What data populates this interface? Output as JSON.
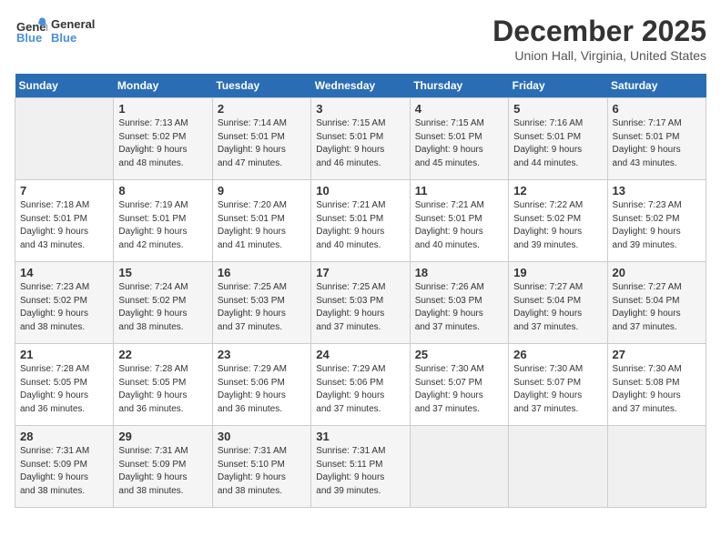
{
  "header": {
    "logo_general": "General",
    "logo_blue": "Blue",
    "month": "December 2025",
    "location": "Union Hall, Virginia, United States"
  },
  "days_of_week": [
    "Sunday",
    "Monday",
    "Tuesday",
    "Wednesday",
    "Thursday",
    "Friday",
    "Saturday"
  ],
  "weeks": [
    [
      {
        "day": "",
        "info": ""
      },
      {
        "day": "1",
        "info": "Sunrise: 7:13 AM\nSunset: 5:02 PM\nDaylight: 9 hours\nand 48 minutes."
      },
      {
        "day": "2",
        "info": "Sunrise: 7:14 AM\nSunset: 5:01 PM\nDaylight: 9 hours\nand 47 minutes."
      },
      {
        "day": "3",
        "info": "Sunrise: 7:15 AM\nSunset: 5:01 PM\nDaylight: 9 hours\nand 46 minutes."
      },
      {
        "day": "4",
        "info": "Sunrise: 7:15 AM\nSunset: 5:01 PM\nDaylight: 9 hours\nand 45 minutes."
      },
      {
        "day": "5",
        "info": "Sunrise: 7:16 AM\nSunset: 5:01 PM\nDaylight: 9 hours\nand 44 minutes."
      },
      {
        "day": "6",
        "info": "Sunrise: 7:17 AM\nSunset: 5:01 PM\nDaylight: 9 hours\nand 43 minutes."
      }
    ],
    [
      {
        "day": "7",
        "info": "Sunrise: 7:18 AM\nSunset: 5:01 PM\nDaylight: 9 hours\nand 43 minutes."
      },
      {
        "day": "8",
        "info": "Sunrise: 7:19 AM\nSunset: 5:01 PM\nDaylight: 9 hours\nand 42 minutes."
      },
      {
        "day": "9",
        "info": "Sunrise: 7:20 AM\nSunset: 5:01 PM\nDaylight: 9 hours\nand 41 minutes."
      },
      {
        "day": "10",
        "info": "Sunrise: 7:21 AM\nSunset: 5:01 PM\nDaylight: 9 hours\nand 40 minutes."
      },
      {
        "day": "11",
        "info": "Sunrise: 7:21 AM\nSunset: 5:01 PM\nDaylight: 9 hours\nand 40 minutes."
      },
      {
        "day": "12",
        "info": "Sunrise: 7:22 AM\nSunset: 5:02 PM\nDaylight: 9 hours\nand 39 minutes."
      },
      {
        "day": "13",
        "info": "Sunrise: 7:23 AM\nSunset: 5:02 PM\nDaylight: 9 hours\nand 39 minutes."
      }
    ],
    [
      {
        "day": "14",
        "info": "Sunrise: 7:23 AM\nSunset: 5:02 PM\nDaylight: 9 hours\nand 38 minutes."
      },
      {
        "day": "15",
        "info": "Sunrise: 7:24 AM\nSunset: 5:02 PM\nDaylight: 9 hours\nand 38 minutes."
      },
      {
        "day": "16",
        "info": "Sunrise: 7:25 AM\nSunset: 5:03 PM\nDaylight: 9 hours\nand 37 minutes."
      },
      {
        "day": "17",
        "info": "Sunrise: 7:25 AM\nSunset: 5:03 PM\nDaylight: 9 hours\nand 37 minutes."
      },
      {
        "day": "18",
        "info": "Sunrise: 7:26 AM\nSunset: 5:03 PM\nDaylight: 9 hours\nand 37 minutes."
      },
      {
        "day": "19",
        "info": "Sunrise: 7:27 AM\nSunset: 5:04 PM\nDaylight: 9 hours\nand 37 minutes."
      },
      {
        "day": "20",
        "info": "Sunrise: 7:27 AM\nSunset: 5:04 PM\nDaylight: 9 hours\nand 37 minutes."
      }
    ],
    [
      {
        "day": "21",
        "info": "Sunrise: 7:28 AM\nSunset: 5:05 PM\nDaylight: 9 hours\nand 36 minutes."
      },
      {
        "day": "22",
        "info": "Sunrise: 7:28 AM\nSunset: 5:05 PM\nDaylight: 9 hours\nand 36 minutes."
      },
      {
        "day": "23",
        "info": "Sunrise: 7:29 AM\nSunset: 5:06 PM\nDaylight: 9 hours\nand 36 minutes."
      },
      {
        "day": "24",
        "info": "Sunrise: 7:29 AM\nSunset: 5:06 PM\nDaylight: 9 hours\nand 37 minutes."
      },
      {
        "day": "25",
        "info": "Sunrise: 7:30 AM\nSunset: 5:07 PM\nDaylight: 9 hours\nand 37 minutes."
      },
      {
        "day": "26",
        "info": "Sunrise: 7:30 AM\nSunset: 5:07 PM\nDaylight: 9 hours\nand 37 minutes."
      },
      {
        "day": "27",
        "info": "Sunrise: 7:30 AM\nSunset: 5:08 PM\nDaylight: 9 hours\nand 37 minutes."
      }
    ],
    [
      {
        "day": "28",
        "info": "Sunrise: 7:31 AM\nSunset: 5:09 PM\nDaylight: 9 hours\nand 38 minutes."
      },
      {
        "day": "29",
        "info": "Sunrise: 7:31 AM\nSunset: 5:09 PM\nDaylight: 9 hours\nand 38 minutes."
      },
      {
        "day": "30",
        "info": "Sunrise: 7:31 AM\nSunset: 5:10 PM\nDaylight: 9 hours\nand 38 minutes."
      },
      {
        "day": "31",
        "info": "Sunrise: 7:31 AM\nSunset: 5:11 PM\nDaylight: 9 hours\nand 39 minutes."
      },
      {
        "day": "",
        "info": ""
      },
      {
        "day": "",
        "info": ""
      },
      {
        "day": "",
        "info": ""
      }
    ]
  ]
}
